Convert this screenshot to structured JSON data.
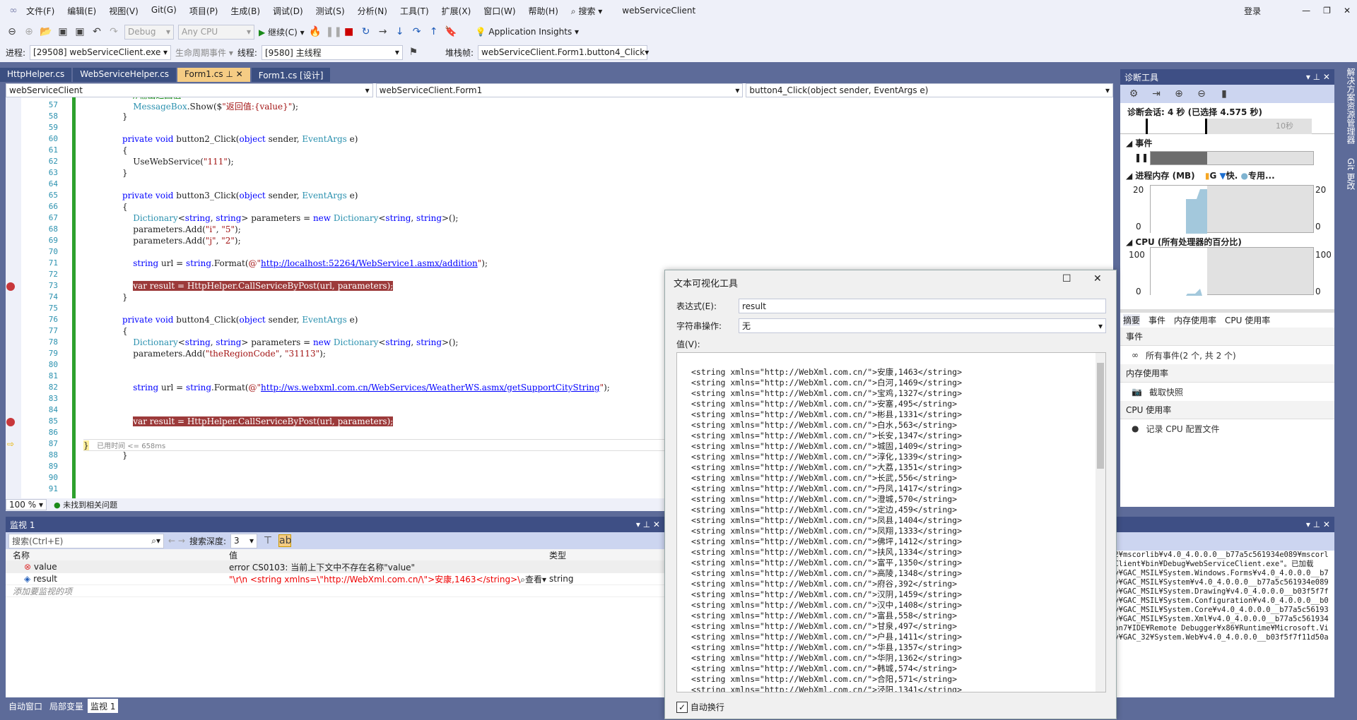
{
  "menu": {
    "items": [
      "文件(F)",
      "编辑(E)",
      "视图(V)",
      "Git(G)",
      "项目(P)",
      "生成(B)",
      "调试(D)",
      "测试(S)",
      "分析(N)",
      "工具(T)",
      "扩展(X)",
      "窗口(W)",
      "帮助(H)"
    ],
    "search": "搜索",
    "title": "webServiceClient",
    "login": "登录"
  },
  "toolbar": {
    "config": "Debug",
    "platform": "Any CPU",
    "continue": "继续(C)",
    "insights": "Application Insights",
    "process_label": "进程:",
    "process": "[29508] webServiceClient.exe",
    "lifecycle": "生命周期事件",
    "thread_label": "线程:",
    "thread": "[9580] 主线程",
    "stack_label": "堆栈帧:",
    "stack": "webServiceClient.Form1.button4_Click"
  },
  "tabs": [
    {
      "label": "HttpHelper.cs"
    },
    {
      "label": "WebServiceHelper.cs"
    },
    {
      "label": "Form1.cs",
      "active": true
    },
    {
      "label": "Form1.cs [设计]"
    }
  ],
  "nav": {
    "project": "webServiceClient",
    "class": "webServiceClient.Form1",
    "member": "button4_Click(object sender, EventArgs e)"
  },
  "code": {
    "start": 56,
    "lines": [
      "    //输出返回值",
      "    MessageBox.Show($\"返回值:{value}\");",
      "}",
      "",
      "private void button2_Click(object sender, EventArgs e)",
      "{",
      "    UseWebService(\"111\");",
      "}",
      "",
      "private void button3_Click(object sender, EventArgs e)",
      "{",
      "    Dictionary<string, string> parameters = new Dictionary<string, string>();",
      "    parameters.Add(\"i\", \"5\");",
      "    parameters.Add(\"j\", \"2\");",
      "",
      "    string url = string.Format(@\"http://localhost:52264/WebService1.asmx/addition\");",
      "",
      "    var result = HttpHelper.CallServiceByPost(url, parameters);",
      "}",
      "",
      "private void button4_Click(object sender, EventArgs e)",
      "{",
      "    Dictionary<string, string> parameters = new Dictionary<string, string>();",
      "    parameters.Add(\"theRegionCode\", \"31113\");",
      "",
      "",
      "    string url = string.Format(@\"http://ws.webxml.com.cn/WebServices/WeatherWS.asmx/getSupportCityString\");",
      "",
      "",
      "    var result = HttpHelper.CallServiceByPost(url, parameters);",
      "",
      "}",
      "}",
      "",
      "",
      ""
    ],
    "breakpoints": [
      73,
      85
    ],
    "current": 87,
    "elapsed": "已用时间 <= 658ms"
  },
  "editor_status": {
    "zoom": "100 %",
    "issues": "未找到相关问题"
  },
  "watch": {
    "title": "监视 1",
    "search_placeholder": "搜索(Ctrl+E)",
    "depth_label": "搜索深度:",
    "depth": "3",
    "columns": [
      "名称",
      "值",
      "类型"
    ],
    "rows": [
      {
        "name": "value",
        "value": "error CS0103: 当前上下文中不存在名称\"value\"",
        "type": ""
      },
      {
        "name": "result",
        "value": "\"\\r\\n  <string xmlns=\\\"http://WebXml.com.cn/\\\">安康,1463</string>\\r...",
        "view": "查看",
        "type": "string"
      }
    ],
    "add": "添加要监视的项"
  },
  "bottom_tabs": [
    "自动窗口",
    "局部变量",
    "监视 1"
  ],
  "diag": {
    "title": "诊断工具",
    "session": "诊断会话: 4 秒 (已选择 4.575 秒)",
    "tick": "10秒",
    "events": "事件",
    "memory": "进程内存 (MB)",
    "legend": [
      "G",
      "快.",
      "专用..."
    ],
    "mem_max": "20",
    "mem_min": "0",
    "cpu": "CPU (所有处理器的百分比)",
    "cpu_max": "100",
    "cpu_min": "0",
    "tabs": [
      "摘要",
      "事件",
      "内存使用率",
      "CPU 使用率"
    ],
    "s_events": "事件",
    "all_events": "所有事件(2 个, 共 2 个)",
    "s_mem": "内存使用率",
    "snapshot": "截取快照",
    "s_cpu": "CPU 使用率",
    "record": "记录 CPU 配置文件"
  },
  "side": [
    "解决方案资源管理器",
    "Git 更改"
  ],
  "output": {
    "lines": [
      "32¥mscorlib¥v4.0_4.0.0.0__b77a5c561934e089¥mscorl",
      "eClient¥bin¥Debug¥webServiceClient.exe\"。已加载",
      "ly¥GAC_MSIL¥System.Windows.Forms¥v4.0_4.0.0.0__b7",
      "ly¥GAC_MSIL¥System¥v4.0_4.0.0.0__b77a5c561934e089",
      "ly¥GAC_MSIL¥System.Drawing¥v4.0_4.0.0.0__b03f5f7f",
      "ly¥GAC_MSIL¥System.Configuration¥v4.0_4.0.0.0__b0",
      "ly¥GAC_MSIL¥System.Core¥v4.0_4.0.0.0__b77a5c56193",
      "ly¥GAC_MSIL¥System.Xml¥v4.0_4.0.0.0__b77a5c561934",
      "mon7¥IDE¥Remote Debugger¥x86¥Runtime¥Microsoft.Vi",
      "ly¥GAC_32¥System.Web¥v4.0_4.0.0.0__b03f5f7f11d50a"
    ]
  },
  "dialog": {
    "title": "文本可视化工具",
    "expr_label": "表达式(E):",
    "expr": "result",
    "op_label": "字符串操作:",
    "op": "无",
    "value_label": "值(V):",
    "wrap": "自动换行",
    "lines": [
      "<string xmlns=\"http://WebXml.com.cn/\">安康,1463</string>",
      "<string xmlns=\"http://WebXml.com.cn/\">白河,1469</string>",
      "<string xmlns=\"http://WebXml.com.cn/\">宝鸡,1327</string>",
      "<string xmlns=\"http://WebXml.com.cn/\">安塞,495</string>",
      "<string xmlns=\"http://WebXml.com.cn/\">彬县,1331</string>",
      "<string xmlns=\"http://WebXml.com.cn/\">白水,563</string>",
      "<string xmlns=\"http://WebXml.com.cn/\">长安,1347</string>",
      "<string xmlns=\"http://WebXml.com.cn/\">城固,1409</string>",
      "<string xmlns=\"http://WebXml.com.cn/\">淳化,1339</string>",
      "<string xmlns=\"http://WebXml.com.cn/\">大荔,1351</string>",
      "<string xmlns=\"http://WebXml.com.cn/\">长武,556</string>",
      "<string xmlns=\"http://WebXml.com.cn/\">丹凤,1417</string>",
      "<string xmlns=\"http://WebXml.com.cn/\">澄城,570</string>",
      "<string xmlns=\"http://WebXml.com.cn/\">定边,459</string>",
      "<string xmlns=\"http://WebXml.com.cn/\">凤县,1404</string>",
      "<string xmlns=\"http://WebXml.com.cn/\">凤翔,1333</string>",
      "<string xmlns=\"http://WebXml.com.cn/\">佛坪,1412</string>",
      "<string xmlns=\"http://WebXml.com.cn/\">扶风,1334</string>",
      "<string xmlns=\"http://WebXml.com.cn/\">富平,1350</string>",
      "<string xmlns=\"http://WebXml.com.cn/\">高陵,1348</string>",
      "<string xmlns=\"http://WebXml.com.cn/\">府谷,392</string>",
      "<string xmlns=\"http://WebXml.com.cn/\">汉阴,1459</string>",
      "<string xmlns=\"http://WebXml.com.cn/\">汉中,1408</string>",
      "<string xmlns=\"http://WebXml.com.cn/\">富县,558</string>",
      "<string xmlns=\"http://WebXml.com.cn/\">甘泉,497</string>",
      "<string xmlns=\"http://WebXml.com.cn/\">户县,1411</string>",
      "<string xmlns=\"http://WebXml.com.cn/\">华县,1357</string>",
      "<string xmlns=\"http://WebXml.com.cn/\">华阴,1362</string>",
      "<string xmlns=\"http://WebXml.com.cn/\">韩城,574</string>",
      "<string xmlns=\"http://WebXml.com.cn/\">合阳,571</string>",
      "<string xmlns=\"http://WebXml.com.cn/\">泾阳,1341</string>"
    ]
  },
  "colors": {
    "accent": "#3e4f85",
    "breakpoint": "#9c3a3a",
    "tab_active": "#f5cc84",
    "memory_fill": "#a3c8dc"
  }
}
